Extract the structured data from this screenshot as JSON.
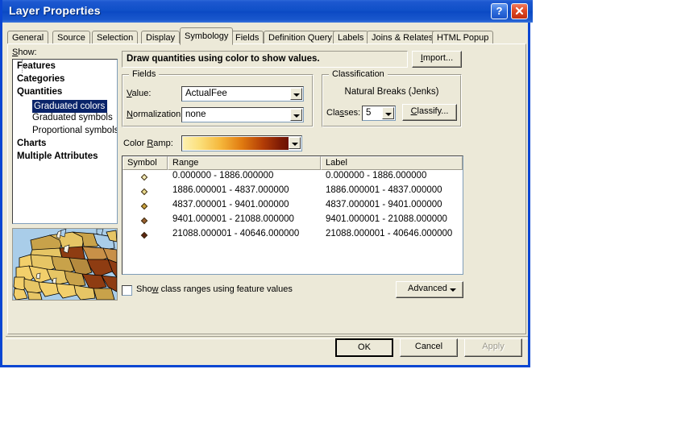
{
  "window": {
    "title": "Layer Properties",
    "help_icon": "question-mark-icon",
    "close_icon": "close-icon"
  },
  "tabs": [
    {
      "label": "General",
      "active": false
    },
    {
      "label": "Source",
      "active": false
    },
    {
      "label": "Selection",
      "active": false
    },
    {
      "label": "Display",
      "active": false
    },
    {
      "label": "Symbology",
      "active": true
    },
    {
      "label": "Fields",
      "active": false
    },
    {
      "label": "Definition Query",
      "active": false
    },
    {
      "label": "Labels",
      "active": false
    },
    {
      "label": "Joins & Relates",
      "active": false
    },
    {
      "label": "HTML Popup",
      "active": false
    }
  ],
  "show": {
    "label": "Show:",
    "tree": [
      {
        "label": "Features",
        "level": 0,
        "selected": false
      },
      {
        "label": "Categories",
        "level": 0,
        "selected": false
      },
      {
        "label": "Quantities",
        "level": 0,
        "selected": false
      },
      {
        "label": "Graduated colors",
        "level": 1,
        "selected": true
      },
      {
        "label": "Graduated symbols",
        "level": 1,
        "selected": false
      },
      {
        "label": "Proportional symbols",
        "level": 1,
        "selected": false
      },
      {
        "label": "Charts",
        "level": 0,
        "selected": false
      },
      {
        "label": "Multiple Attributes",
        "level": 0,
        "selected": false
      }
    ]
  },
  "description": "Draw quantities using color to show values.",
  "import_button": "Import...",
  "fields_group": {
    "title": "Fields",
    "value_label": "Value:",
    "value_selected": "ActualFee",
    "normalization_label": "Normalization:",
    "normalization_selected": "none"
  },
  "classification_group": {
    "title": "Classification",
    "method": "Natural Breaks (Jenks)",
    "classes_label": "Classes:",
    "classes_value": "5",
    "classify_button": "Classify..."
  },
  "color_ramp": {
    "label": "Color Ramp:",
    "start_color": "#fdf0b0",
    "end_color": "#6b1203"
  },
  "legend_table": {
    "columns": [
      "Symbol",
      "Range",
      "Label"
    ],
    "rows": [
      {
        "color": "#f2eab4",
        "range": "0.000000 - 1886.000000",
        "label": "0.000000 - 1886.000000"
      },
      {
        "color": "#e8d98c",
        "range": "1886.000001 - 4837.000000",
        "label": "1886.000001 - 4837.000000"
      },
      {
        "color": "#c9a13c",
        "range": "4837.000001 - 9401.000000",
        "label": "4837.000001 - 9401.000000"
      },
      {
        "color": "#9a6030",
        "range": "9401.000001 - 21088.000000",
        "label": "9401.000001 - 21088.000000"
      },
      {
        "color": "#5e2410",
        "range": "21088.000001 - 40646.000000",
        "label": "21088.000001 - 40646.000000"
      }
    ]
  },
  "show_class_ranges": {
    "label": "Show class ranges using feature values",
    "checked": false
  },
  "advanced_button": "Advanced",
  "footer": {
    "ok": "OK",
    "cancel": "Cancel",
    "apply": "Apply",
    "apply_enabled": false
  },
  "map_preview": {
    "ocean_color": "#a9cde9",
    "outline_color": "#000000"
  }
}
